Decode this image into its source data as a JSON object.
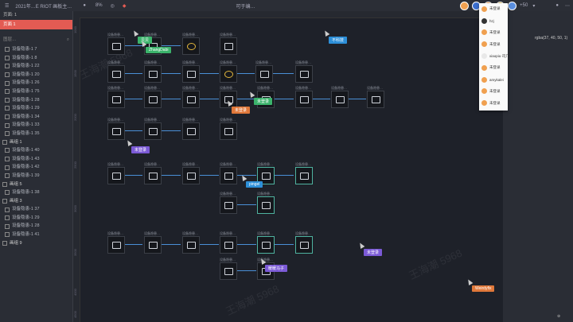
{
  "topbar": {
    "filename": "2021年…E RIOT 画板主…",
    "zoom": "8%",
    "center_label": "可于编…",
    "collab_count": "+50",
    "colors": {
      "bg": "#2b2e36",
      "accent": "#e35b53"
    }
  },
  "sidebar": {
    "pages_header": "页面: 1",
    "page_item": "页面 1",
    "search_placeholder": "图层…",
    "layers": [
      {
        "label": "设备隐患-1 7",
        "group": false
      },
      {
        "label": "设备隐患-1 8",
        "group": false
      },
      {
        "label": "设备隐患-1 22",
        "group": false
      },
      {
        "label": "设备隐患-1 20",
        "group": false
      },
      {
        "label": "设备隐患-1 26",
        "group": false
      },
      {
        "label": "设备隐患-1 75",
        "group": false
      },
      {
        "label": "设备隐患-1 28",
        "group": false
      },
      {
        "label": "设备隐患-1 29",
        "group": false
      },
      {
        "label": "设备隐患-1 34",
        "group": false
      },
      {
        "label": "设备隐患-1 33",
        "group": false
      },
      {
        "label": "设备隐患-1 35",
        "group": false
      },
      {
        "label": "画组 1",
        "group": true
      },
      {
        "label": "设备隐患-1 40",
        "group": false
      },
      {
        "label": "设备隐患-1 43",
        "group": false
      },
      {
        "label": "设备隐患-1 42",
        "group": false
      },
      {
        "label": "设备隐患-1 39",
        "group": false
      },
      {
        "label": "画组 5",
        "group": true
      },
      {
        "label": "设备隐患-1 38",
        "group": false
      },
      {
        "label": "画组 3",
        "group": true
      },
      {
        "label": "设备隐患-1 37",
        "group": false
      },
      {
        "label": "设备隐患-1 29",
        "group": false
      },
      {
        "label": "设备隐患-1 28",
        "group": false
      },
      {
        "label": "设备隐患-1 41",
        "group": false
      },
      {
        "label": "画组 9",
        "group": true
      }
    ]
  },
  "ruler": {
    "marks": [
      "1000",
      "1500",
      "2000",
      "2500",
      "3000",
      "3500",
      "4000",
      "4500"
    ]
  },
  "canvas": {
    "node_label": "设备隐患…",
    "tags": [
      {
        "text": "贝贝",
        "color": "#3bb36b"
      },
      {
        "text": "ZhangDabi",
        "color": "#3bb36b"
      },
      {
        "text": "不科技",
        "color": "#2d8fd8"
      },
      {
        "text": "未登录",
        "color": "#e0783a"
      },
      {
        "text": "未登录",
        "color": "#3bb36b"
      },
      {
        "text": "未登录",
        "color": "#7b5ad6"
      },
      {
        "text": "pingel",
        "color": "#2d8fd8"
      },
      {
        "text": "未登录",
        "color": "#7b5ad6"
      },
      {
        "text": "暖暖马子",
        "color": "#7b5ad6"
      },
      {
        "text": "Weirdyfix",
        "color": "#e0783a"
      }
    ],
    "watermark": "王海潮 5968"
  },
  "inspector": {
    "fill_value": "rgba(37, 40, 50, 1)"
  },
  "collaborators": {
    "items": [
      {
        "name": "未登录"
      },
      {
        "name": "hzj"
      },
      {
        "name": "未登录"
      },
      {
        "name": "未登录"
      },
      {
        "name": "xiaopiu·司几"
      },
      {
        "name": "未登录"
      },
      {
        "name": "amykalei"
      },
      {
        "name": "未登录"
      },
      {
        "name": "未登录"
      }
    ]
  },
  "statusbar": {
    "text": "⊕"
  }
}
